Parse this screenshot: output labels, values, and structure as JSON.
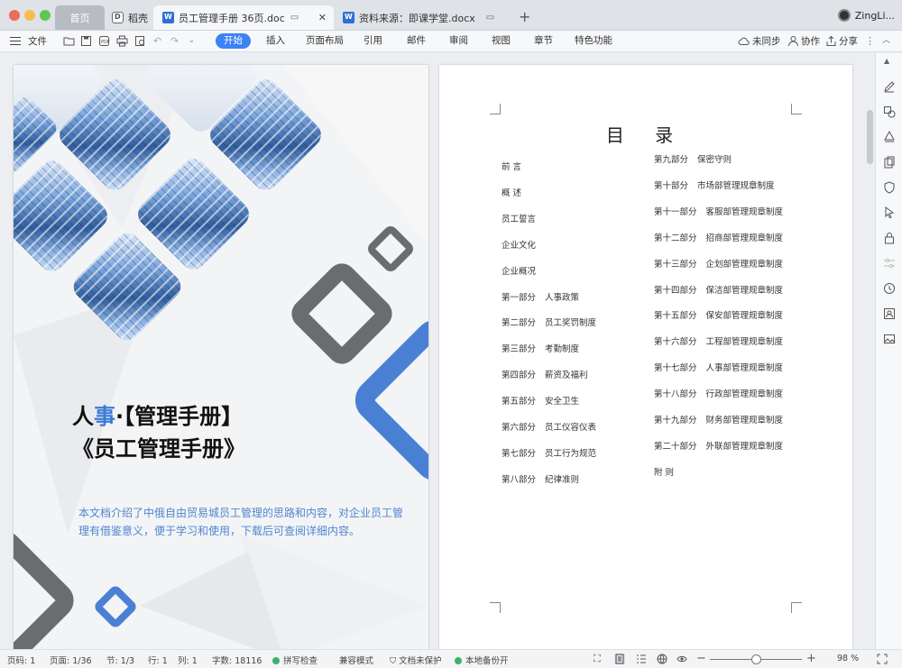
{
  "window": {
    "traffic_lights": {
      "close": "#ed6a5e",
      "minimize": "#f5bf4f",
      "zoom": "#62c655"
    },
    "tabs": [
      {
        "label": "首页",
        "icon": "home"
      },
      {
        "label": "稻壳",
        "icon": "docer-icon"
      },
      {
        "label": "员工管理手册 36页.doc",
        "icon": "word-doc-icon",
        "active": true
      },
      {
        "label": "资料来源：即课学堂.docx",
        "icon": "word-doc-icon"
      }
    ],
    "new_tab": "+",
    "user": "ZingLi..."
  },
  "toolbar": {
    "file": "文件",
    "menus": [
      "开始",
      "插入",
      "页面布局",
      "引用",
      "邮件",
      "审阅",
      "视图",
      "章节",
      "特色功能"
    ],
    "active_menu": "开始",
    "sync": "未同步",
    "collab": "协作",
    "share": "分享",
    "accent": "#3b82f6"
  },
  "cover": {
    "title_line1_a": "人",
    "title_line1_hl": "事",
    "title_line1_b": "·【管理手册】",
    "title_line2": "《员工管理手册》",
    "description": "本文档介绍了中俄自由贸易城员工管理的思路和内容，对企业员工管理有借鉴意义，便于学习和使用，下载后可查阅详细内容。",
    "accent_blue": "#4a80d4",
    "accent_gray": "#6b6c6e"
  },
  "toc": {
    "title": "目 录",
    "left": [
      {
        "part": "前 言",
        "title": ""
      },
      {
        "part": "概 述",
        "title": ""
      },
      {
        "part": "员工誓言",
        "title": ""
      },
      {
        "part": "企业文化",
        "title": ""
      },
      {
        "part": "企业概况",
        "title": ""
      },
      {
        "part": "第一部分",
        "title": "人事政策"
      },
      {
        "part": "第二部分",
        "title": "员工奖罚制度"
      },
      {
        "part": "第三部分",
        "title": "考勤制度"
      },
      {
        "part": "第四部分",
        "title": "薪资及福利"
      },
      {
        "part": "第五部分",
        "title": "安全卫生"
      },
      {
        "part": "第六部分",
        "title": "员工仪容仪表"
      },
      {
        "part": "第七部分",
        "title": "员工行为规范"
      },
      {
        "part": "第八部分",
        "title": "纪律准则"
      }
    ],
    "right": [
      {
        "part": "第九部分",
        "title": "保密守则"
      },
      {
        "part": "第十部分",
        "title": "市场部管理规章制度"
      },
      {
        "part": "第十一部分",
        "title": "客服部管理规章制度"
      },
      {
        "part": "第十二部分",
        "title": "招商部管理规章制度"
      },
      {
        "part": "第十三部分",
        "title": "企划部管理规章制度"
      },
      {
        "part": "第十四部分",
        "title": "保洁部管理规章制度"
      },
      {
        "part": "第十五部分",
        "title": "保安部管理规章制度"
      },
      {
        "part": "第十六部分",
        "title": "工程部管理规章制度"
      },
      {
        "part": "第十七部分",
        "title": "人事部管理规章制度"
      },
      {
        "part": "第十八部分",
        "title": "行政部管理规章制度"
      },
      {
        "part": "第十九部分",
        "title": "财务部管理规章制度"
      },
      {
        "part": "第二十部分",
        "title": "外联部管理规章制度"
      },
      {
        "part": "附 则",
        "title": ""
      }
    ]
  },
  "status": {
    "page_code": "页码: 1",
    "page": "页面: 1/36",
    "section": "节: 1/3",
    "row": "行: 1",
    "col": "列: 1",
    "words": "字数: 18116",
    "spellcheck": "拼写检查",
    "compat": "兼容模式",
    "protect": "文档未保护",
    "backup": "本地备份开",
    "zoom": "98 %",
    "zoom_level_fraction": 0.5
  }
}
